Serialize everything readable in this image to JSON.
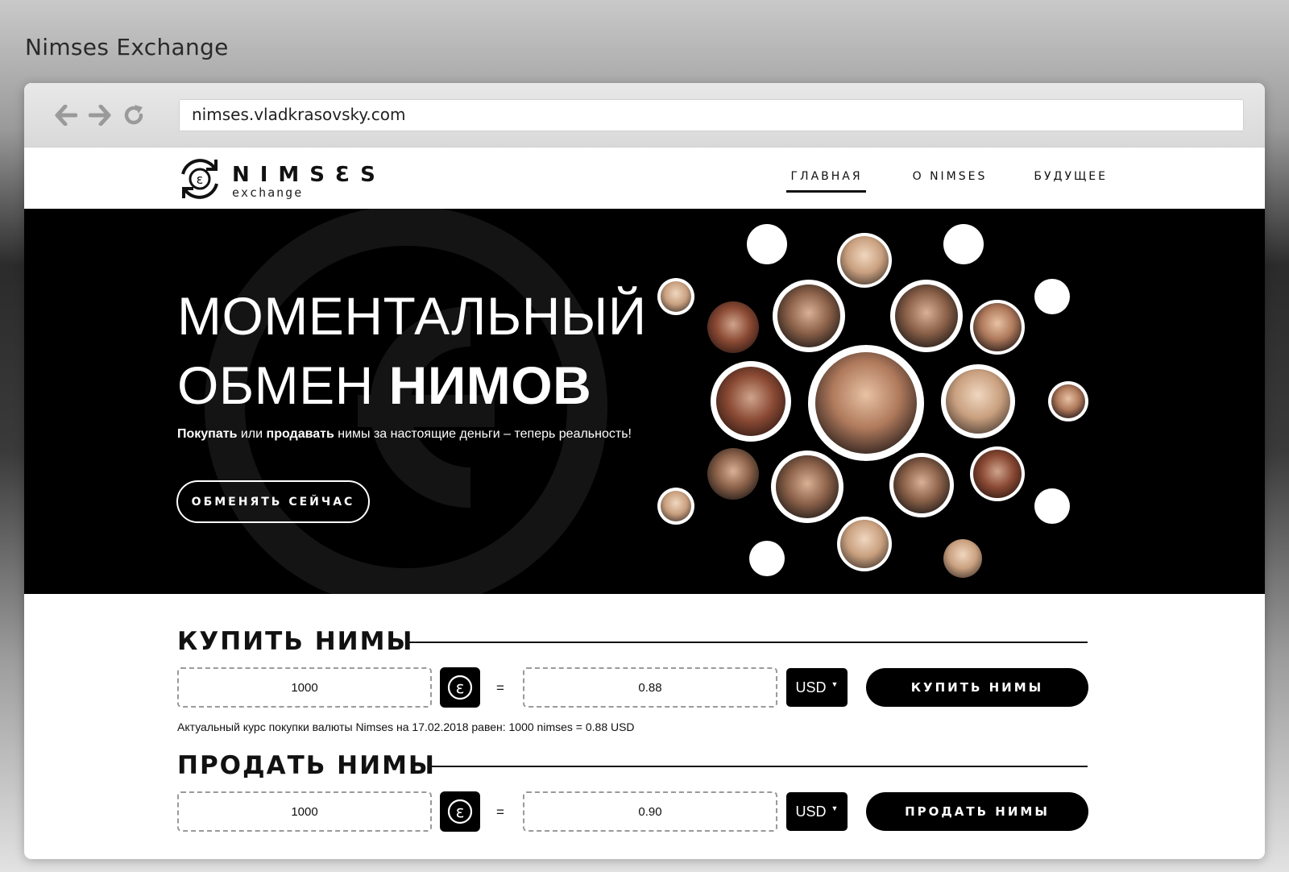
{
  "showcase": {
    "title": "Nimses Exchange"
  },
  "browser": {
    "url": "nimses.vladkrasovsky.com",
    "icons": {
      "back": "arrow-left-icon",
      "forward": "arrow-right-icon",
      "reload": "reload-icon"
    }
  },
  "header": {
    "logo_main": "NIMSƐS",
    "logo_sub": "exchange",
    "menu": [
      {
        "label": "ГЛАВНАЯ",
        "active": true
      },
      {
        "label": "О NIMSES",
        "active": false
      },
      {
        "label": "БУДУЩЕЕ",
        "active": false
      }
    ]
  },
  "hero": {
    "title_line1": "МОМЕНТАЛЬНЫЙ",
    "title_line2_regular": "ОБМЕН ",
    "title_line2_bold": "НИМОВ",
    "sub_buy": "Покупать",
    "sub_or": " или ",
    "sub_sell": "продавать",
    "sub_rest": " нимы за настоящие деньги – теперь реальность!",
    "cta_label": "ОБМЕНЯТЬ СЕЙЧАС"
  },
  "buy": {
    "title": "КУПИТЬ НИМЫ",
    "nims_value": "1000",
    "equals": "=",
    "money_value": "0.88",
    "currency": "USD",
    "button_label": "КУПИТЬ НИМЫ",
    "rate_note": "Актуальный курс покупки валюты Nimses на 17.02.2018 равен: 1000 nimses = 0.88 USD"
  },
  "sell": {
    "title": "ПРОДАТЬ НИМЫ",
    "nims_value": "1000",
    "equals": "=",
    "money_value": "0.90",
    "currency": "USD",
    "button_label": "ПРОДАТЬ НИМЫ"
  },
  "colors": {
    "accent": "#000000",
    "background": "#ffffff",
    "hero_bg": "#000000"
  }
}
